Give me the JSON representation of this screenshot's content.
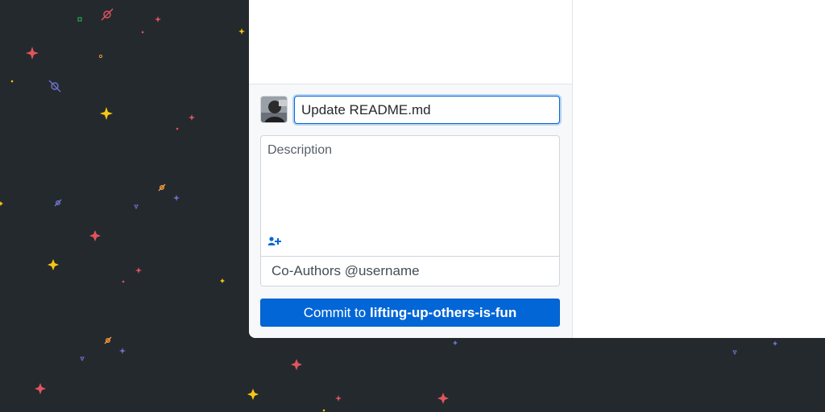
{
  "commit": {
    "summary_value": "Update README.md",
    "description_placeholder": "Description",
    "coauthors_placeholder": "Co-Authors @username",
    "button_prefix": "Commit to ",
    "branch_name": "lifting-up-others-is-fun"
  },
  "icons": {
    "avatar": "user-avatar",
    "coauthor_toggle": "person-add-icon"
  },
  "colors": {
    "background": "#24292e",
    "primary_button": "#0366d6",
    "focus_border": "#0366d6",
    "commit_panel": "#f6f8fa"
  }
}
